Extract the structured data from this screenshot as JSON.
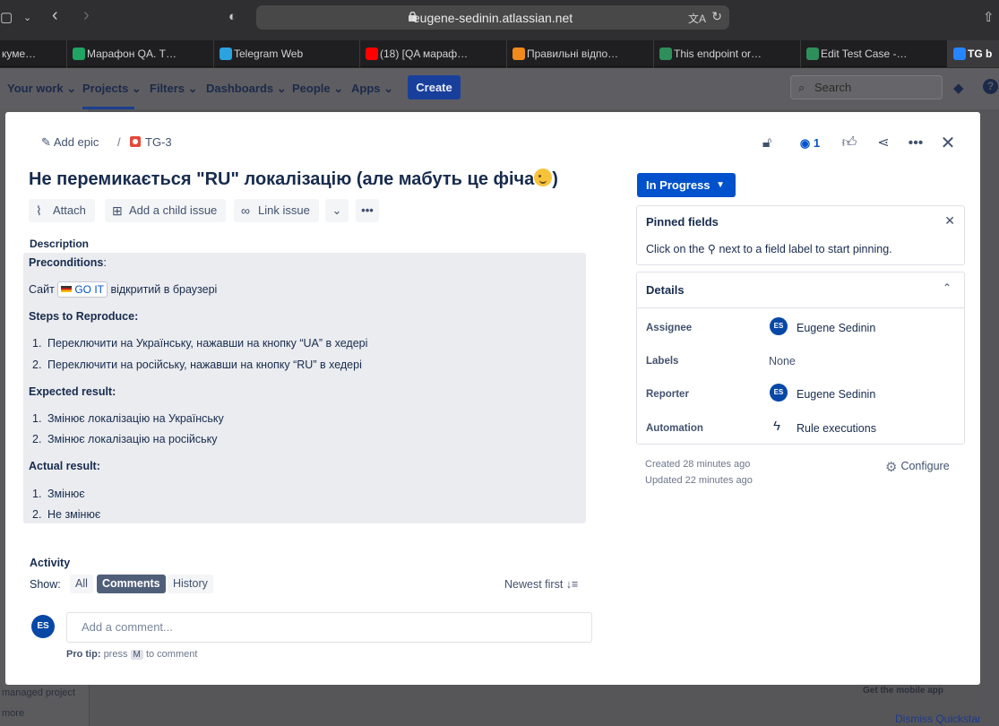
{
  "browser": {
    "url": "eugene-sedinin.atlassian.net",
    "tabs": [
      {
        "label": "кумe…",
        "color": "#555555"
      },
      {
        "label": "Марафон QA. Т…",
        "color": "#1fa463"
      },
      {
        "label": "Telegram Web",
        "color": "#2aa3de"
      },
      {
        "label": "(18) [QA мараф…",
        "color": "#ff0000"
      },
      {
        "label": "Правильні відпо…",
        "color": "#f08a1c"
      },
      {
        "label": "This endpoint or…",
        "color": "#2f8f5a"
      },
      {
        "label": "Edit Test Case -…",
        "color": "#2f8f5a"
      },
      {
        "label": "TG b",
        "color": "#2684ff"
      }
    ]
  },
  "jira_nav": {
    "items": [
      "Your work",
      "Projects",
      "Filters",
      "Dashboards",
      "People",
      "Apps"
    ],
    "create_label": "Create",
    "search_placeholder": "Search"
  },
  "background": {
    "left_items": [
      "managed project",
      "more"
    ],
    "right_items": [
      "Get the mobile app",
      "Dismiss Quickstart"
    ]
  },
  "issue": {
    "add_epic": "Add epic",
    "separator": "/",
    "key": "TG-3",
    "watch_count": "1",
    "title": "Не перемикається \"RU\" локалізацію (але мабуть це фіча",
    "title_end": ")",
    "toolbar": {
      "attach": "Attach",
      "child": "Add a child issue",
      "link": "Link issue"
    },
    "description_label": "Description",
    "description": {
      "preconditions_label": "Preconditions",
      "preconditions_colon": ":",
      "site_prefix": "Сайт",
      "site_link": "GO IT",
      "site_suffix": "відкритий в браузері",
      "steps_label": "Steps to Reproduce:",
      "steps": [
        "Переключити на Українську, нажавши на кнопку “UA” в хедері",
        "Переключити на російську, нажавши на кнопку “RU” в хедері"
      ],
      "expected_label": "Expected result:",
      "expected": [
        "Змінює локалізацію на Українську",
        "Змінює локалізацію на російську"
      ],
      "actual_label": "Actual result:",
      "actual": [
        "Змінює",
        "Не змінює"
      ]
    },
    "activity": {
      "label": "Activity",
      "show_label": "Show:",
      "filters": [
        "All",
        "Comments",
        "History"
      ],
      "selected_filter": "Comments",
      "sort_label": "Newest first",
      "comment_placeholder": "Add a comment...",
      "avatar_initials": "ES",
      "protip_label": "Pro tip:",
      "protip_press": "press",
      "protip_key": "M",
      "protip_rest": "to comment"
    }
  },
  "sidebar": {
    "status": "In Progress",
    "pinned": {
      "title": "Pinned fields",
      "text_before": "Click on the",
      "text_after": "next to a field label to start pinning."
    },
    "details": {
      "title": "Details",
      "fields": [
        {
          "key": "Assignee",
          "value": "Eugene Sedinin",
          "initials": "ES"
        },
        {
          "key": "Labels",
          "value": "None"
        },
        {
          "key": "Reporter",
          "value": "Eugene Sedinin",
          "initials": "ES"
        },
        {
          "key": "Automation",
          "value": "Rule executions"
        }
      ]
    },
    "created": "Created 28 minutes ago",
    "updated": "Updated 22 minutes ago",
    "configure": "Configure"
  },
  "colors": {
    "primary": "#0052cc",
    "bug": "#e5493a",
    "avatar": "#0747a6"
  }
}
